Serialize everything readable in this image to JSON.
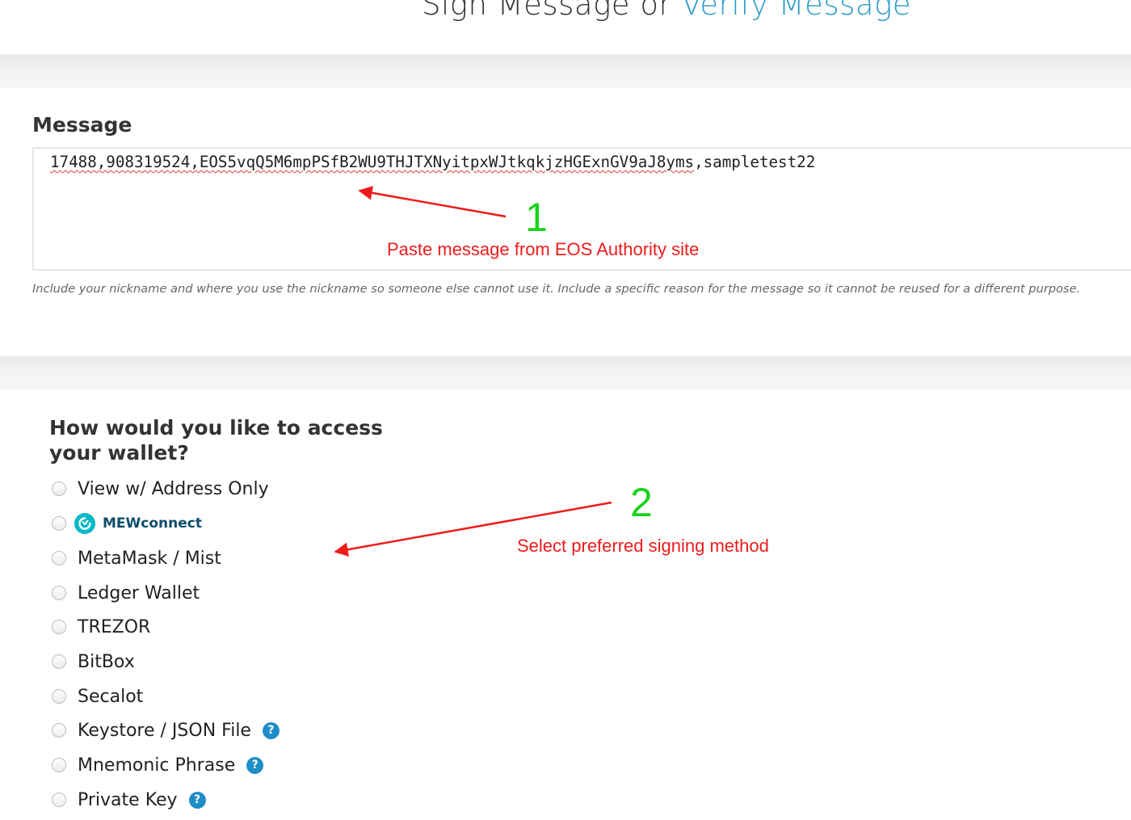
{
  "header": {
    "title_part1": "Sign Message or ",
    "title_link": "Verify Message"
  },
  "message": {
    "label": "Message",
    "value_underlined": "17488,908319524,EOS5vqQ5M6mpPSfB2WU9THJTXNyitpxWJtkqkjzHGExnGV9aJ8yms",
    "value_rest": ",sampletest22",
    "hint": "Include your nickname and where you use the nickname so someone else cannot use it. Include a specific reason for the message so it cannot be reused for a different purpose."
  },
  "wallet": {
    "title": "How would you like to access your wallet?",
    "options": [
      {
        "label": "View w/ Address Only",
        "help": false
      },
      {
        "label": "MEWconnect",
        "help": false
      },
      {
        "label": "MetaMask / Mist",
        "help": false
      },
      {
        "label": "Ledger Wallet",
        "help": false
      },
      {
        "label": "TREZOR",
        "help": false
      },
      {
        "label": "BitBox",
        "help": false
      },
      {
        "label": "Secalot",
        "help": false
      },
      {
        "label": "Keystore / JSON File",
        "help": true
      },
      {
        "label": "Mnemonic Phrase",
        "help": true
      },
      {
        "label": "Private Key",
        "help": true
      }
    ],
    "help_glyph": "?"
  },
  "annotations": {
    "step1_number": "1",
    "step1_text": "Paste message from EOS Authority site",
    "step2_number": "2",
    "step2_text": "Select preferred signing method",
    "number_color": "#19d319",
    "text_color": "#ee1c1c"
  },
  "colors": {
    "link": "#2a9bc9",
    "help_icon": "#1f8dc8",
    "mewconnect_brand": "#06b9c6"
  }
}
